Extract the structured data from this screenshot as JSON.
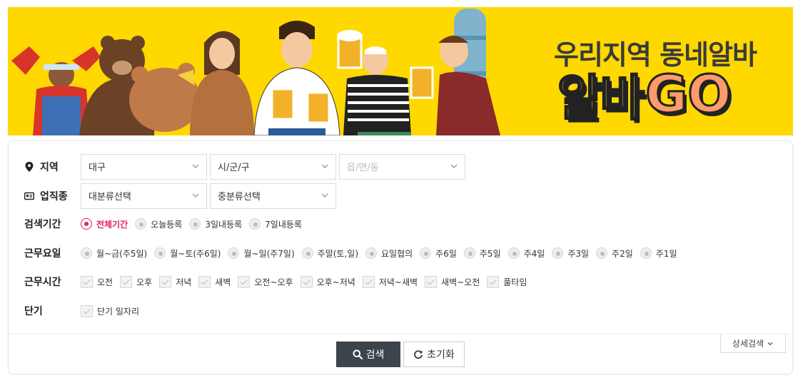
{
  "banner": {
    "subtitle": "우리지역 동네알바",
    "logo_korean": "알바",
    "logo_go": "GO",
    "background": "#ffd800"
  },
  "filters": {
    "region": {
      "label": "지역",
      "icon": "location-pin-icon",
      "selects": [
        {
          "value": "대구",
          "disabled": false
        },
        {
          "value": "시/군/구",
          "disabled": false
        },
        {
          "value": "읍/면/동",
          "disabled": true
        }
      ]
    },
    "job_type": {
      "label": "업직종",
      "icon": "id-card-icon",
      "selects": [
        {
          "value": "대분류선택"
        },
        {
          "value": "중분류선택"
        }
      ]
    },
    "period": {
      "label": "검색기간",
      "options": [
        "전체기간",
        "오늘등록",
        "3일내등록",
        "7일내등록"
      ],
      "selected": "전체기간"
    },
    "workdays": {
      "label": "근무요일",
      "options": [
        "월~금(주5일)",
        "월~토(주6일)",
        "월~일(주7일)",
        "주말(토,일)",
        "요일협의",
        "주6일",
        "주5일",
        "주4일",
        "주3일",
        "주2일",
        "주1일"
      ]
    },
    "worktime": {
      "label": "근무시간",
      "options": [
        "오전",
        "오후",
        "저녁",
        "새벽",
        "오전~오후",
        "오후~저녁",
        "저녁~새벽",
        "새벽~오전",
        "풀타임"
      ]
    },
    "short_term": {
      "label": "단기",
      "options": [
        "단기 일자리"
      ]
    }
  },
  "actions": {
    "search_label": "검색",
    "reset_label": "초기화",
    "detail_label": "상세검색"
  },
  "colors": {
    "accent": "#e0245e",
    "search_button": "#3c444c"
  }
}
